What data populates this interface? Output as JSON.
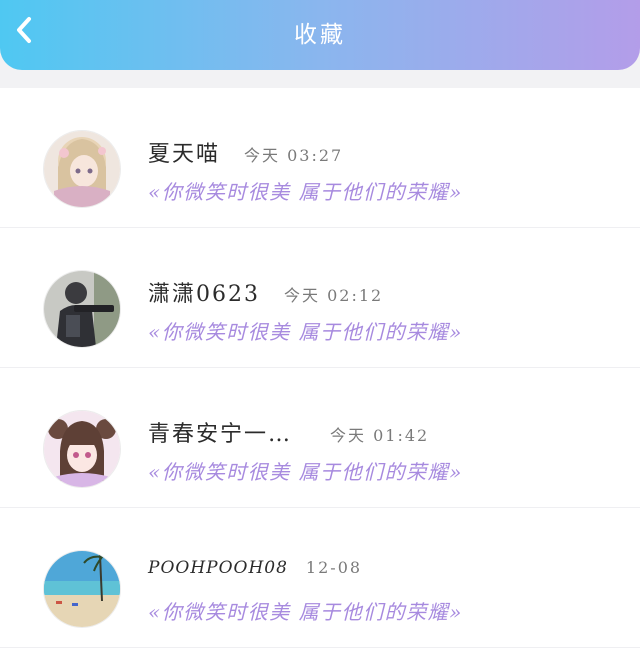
{
  "header": {
    "title": "收藏",
    "back_icon": "chevron-left-icon"
  },
  "favorites": [
    {
      "name": "夏天喵",
      "time": "今天 03:27",
      "quote": "«你微笑时很美 属于他们的荣耀»",
      "avatar": "anime-girl-blonde-avatar"
    },
    {
      "name": "潇潇0623",
      "time": "今天 02:12",
      "quote": "«你微笑时很美 属于他们的荣耀»",
      "avatar": "soldier-avatar"
    },
    {
      "name": "青春安宁一…",
      "time": "今天 01:42",
      "quote": "«你微笑时很美 属于他们的荣耀»",
      "avatar": "anime-girl-brown-hair-avatar"
    },
    {
      "name": "POOHPOOH08",
      "time": "12-08",
      "quote": "«你微笑时很美 属于他们的荣耀»",
      "avatar": "beach-avatar"
    }
  ],
  "colors": {
    "header_start": "#4fc8f2",
    "header_end": "#b39de9",
    "quote": "#a78adf"
  }
}
